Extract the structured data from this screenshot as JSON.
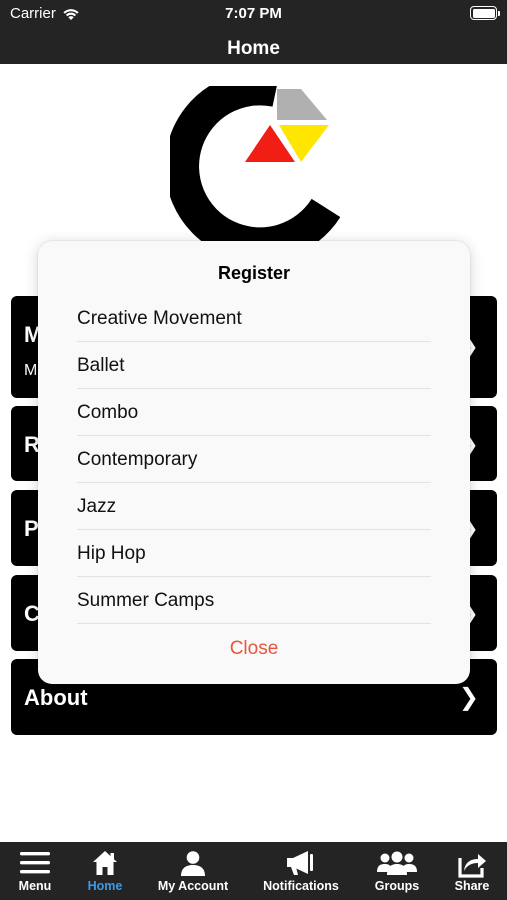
{
  "status": {
    "carrier": "Carrier",
    "time": "7:07 PM"
  },
  "header": {
    "title": "Home"
  },
  "tiles": [
    {
      "title": "M",
      "subtitle": "M"
    },
    {
      "title": "R"
    },
    {
      "title": "P"
    },
    {
      "title": "C"
    },
    {
      "title": "About"
    }
  ],
  "chevron": "❯",
  "dialog": {
    "title": "Register",
    "options": [
      "Creative Movement",
      "Ballet",
      "Combo",
      "Contemporary",
      "Jazz",
      "Hip Hop",
      "Summer Camps"
    ],
    "close_label": "Close"
  },
  "tabbar": {
    "items": [
      {
        "label": "Menu",
        "icon": "menu-icon"
      },
      {
        "label": "Home",
        "icon": "home-icon",
        "active": true
      },
      {
        "label": "My Account",
        "icon": "person-icon"
      },
      {
        "label": "Notifications",
        "icon": "megaphone-icon"
      },
      {
        "label": "Groups",
        "icon": "group-icon"
      },
      {
        "label": "Share",
        "icon": "share-icon"
      }
    ]
  },
  "colors": {
    "bar": "#242424",
    "accent": "#3b9be8",
    "close": "#e9553f",
    "logo_red": "#f01e14",
    "logo_yellow": "#ffe600",
    "logo_gray": "#b0b0b0"
  }
}
